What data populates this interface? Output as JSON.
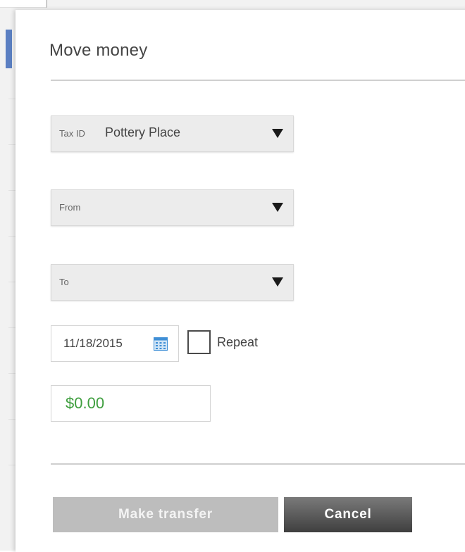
{
  "dialog": {
    "title": "Move money"
  },
  "tax_id_select": {
    "label": "Tax ID",
    "value": "Pottery Place"
  },
  "from_select": {
    "label": "From",
    "value": ""
  },
  "to_select": {
    "label": "To",
    "value": ""
  },
  "date_field": {
    "value": "11/18/2015",
    "icon": "calendar-icon"
  },
  "repeat": {
    "label": "Repeat",
    "checked": false
  },
  "amount_field": {
    "value": "$0.00"
  },
  "actions": {
    "primary_label": "Make transfer",
    "cancel_label": "Cancel"
  },
  "colors": {
    "amount": "#3e9e3e",
    "accent_bar": "#5b7fc2",
    "primary_button_disabled": "#bdbdbd",
    "cancel_button": "#4a4a4a"
  }
}
